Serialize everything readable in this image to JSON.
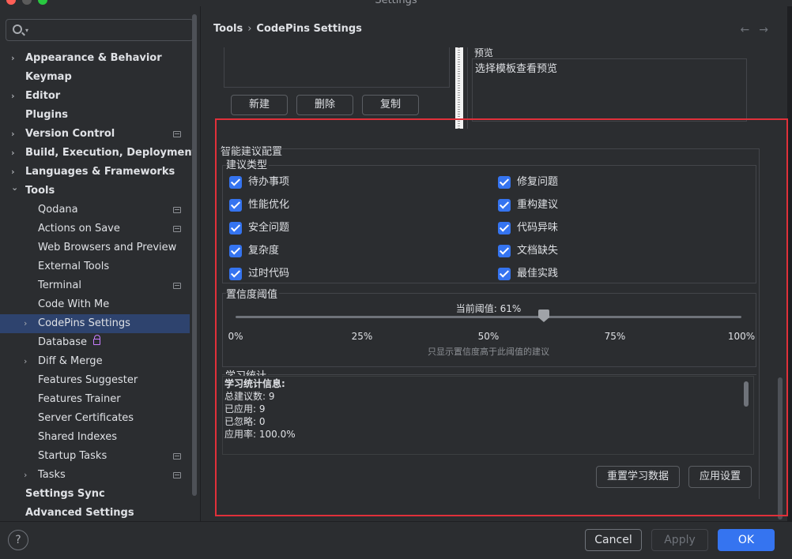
{
  "window": {
    "title": "Settings"
  },
  "search": {
    "placeholder": ""
  },
  "sidebar": {
    "items": [
      {
        "label": "Appearance & Behavior",
        "arrow": "›",
        "level": 0,
        "bold": true
      },
      {
        "label": "Keymap",
        "arrow": "",
        "level": 0,
        "bold": true
      },
      {
        "label": "Editor",
        "arrow": "›",
        "level": 0,
        "bold": true
      },
      {
        "label": "Plugins",
        "arrow": "",
        "level": 0,
        "bold": true
      },
      {
        "label": "Version Control",
        "arrow": "›",
        "level": 0,
        "bold": true,
        "badge": true
      },
      {
        "label": "Build, Execution, Deployment",
        "arrow": "›",
        "level": 0,
        "bold": true
      },
      {
        "label": "Languages & Frameworks",
        "arrow": "›",
        "level": 0,
        "bold": true
      },
      {
        "label": "Tools",
        "arrow": "⌄",
        "level": 0,
        "bold": true
      },
      {
        "label": "Qodana",
        "arrow": "",
        "level": 1,
        "badge": true
      },
      {
        "label": "Actions on Save",
        "arrow": "",
        "level": 1,
        "badge": true
      },
      {
        "label": "Web Browsers and Preview",
        "arrow": "",
        "level": 1
      },
      {
        "label": "External Tools",
        "arrow": "",
        "level": 1
      },
      {
        "label": "Terminal",
        "arrow": "",
        "level": 1,
        "badge": true
      },
      {
        "label": "Code With Me",
        "arrow": "",
        "level": 1
      },
      {
        "label": "CodePins Settings",
        "arrow": "›",
        "level": 1,
        "selected": true
      },
      {
        "label": "Database",
        "arrow": "",
        "level": 1,
        "lock": true
      },
      {
        "label": "Diff & Merge",
        "arrow": "›",
        "level": 1
      },
      {
        "label": "Features Suggester",
        "arrow": "",
        "level": 1
      },
      {
        "label": "Features Trainer",
        "arrow": "",
        "level": 1
      },
      {
        "label": "Server Certificates",
        "arrow": "",
        "level": 1
      },
      {
        "label": "Shared Indexes",
        "arrow": "",
        "level": 1
      },
      {
        "label": "Startup Tasks",
        "arrow": "",
        "level": 1,
        "badge": true
      },
      {
        "label": "Tasks",
        "arrow": "›",
        "level": 1,
        "badge": true
      },
      {
        "label": "Settings Sync",
        "arrow": "",
        "level": 0,
        "bold": true
      },
      {
        "label": "Advanced Settings",
        "arrow": "",
        "level": 0,
        "bold": true
      }
    ]
  },
  "breadcrumb": {
    "root": "Tools",
    "separator": "›",
    "current": "CodePins Settings"
  },
  "nav": {
    "back": "←",
    "forward": "→"
  },
  "templates": {
    "new_label": "新建",
    "delete_label": "删除",
    "copy_label": "复制",
    "preview_title": "预览",
    "preview_text": "选择模板查看预览"
  },
  "smart": {
    "title": "智能建议配置",
    "types_title": "建议类型",
    "types": [
      {
        "label": "待办事项",
        "checked": true
      },
      {
        "label": "修复问题",
        "checked": true
      },
      {
        "label": "性能优化",
        "checked": true
      },
      {
        "label": "重构建议",
        "checked": true
      },
      {
        "label": "安全问题",
        "checked": true
      },
      {
        "label": "代码异味",
        "checked": true
      },
      {
        "label": "复杂度",
        "checked": true
      },
      {
        "label": "文档缺失",
        "checked": true
      },
      {
        "label": "过时代码",
        "checked": true
      },
      {
        "label": "最佳实践",
        "checked": true
      }
    ],
    "threshold_title": "置信度阈值",
    "threshold_label": "当前阈值: 61%",
    "threshold_value": 61,
    "ticks": [
      "0%",
      "25%",
      "50%",
      "75%",
      "100%"
    ],
    "hint": "只显示置信度高于此阈值的建议",
    "stats_title": "学习统计",
    "stats_lines": [
      "学习统计信息:",
      "总建议数: 9",
      "已应用: 9",
      "已忽略: 0",
      "应用率: 100.0%"
    ],
    "reset_label": "重置学习数据",
    "apply_settings_label": "应用设置"
  },
  "footer": {
    "help": "?",
    "cancel": "Cancel",
    "apply": "Apply",
    "ok": "OK"
  },
  "colors": {
    "accent": "#3574f0",
    "selection": "#2e436e",
    "highlight_outline": "#e0303a"
  }
}
